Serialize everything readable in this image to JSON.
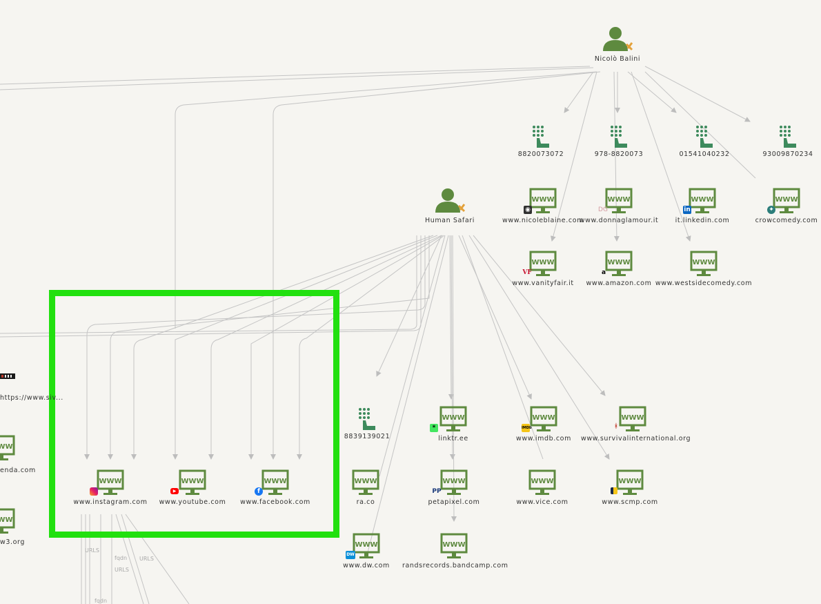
{
  "persons": {
    "nicolo": {
      "label": "Nicolò Balini"
    },
    "human_safari": {
      "label": "Human Safari"
    }
  },
  "phones": {
    "p1": {
      "label": "8820073072"
    },
    "p2": {
      "label": "978-8820073"
    },
    "p3": {
      "label": "01541040232"
    },
    "p4": {
      "label": "93009870234"
    },
    "p5": {
      "label": "8839139021"
    }
  },
  "sites": {
    "nicoleblaine": {
      "label": "www.nicoleblaine.com",
      "badge": "portrait-icon"
    },
    "donnaglamour": {
      "label": "www.donnaglamour.it",
      "badge_text": "DG"
    },
    "linkedin": {
      "label": "it.linkedin.com",
      "badge_text": "in"
    },
    "crowcomedy": {
      "label": "crowcomedy.com",
      "badge": "crow-icon"
    },
    "vanityfair": {
      "label": "www.vanityfair.it",
      "badge_text": "VF"
    },
    "amazon": {
      "label": "www.amazon.com",
      "badge_text": "a"
    },
    "westsidecomedy": {
      "label": "www.westsidecomedy.com"
    },
    "linktree": {
      "label": "linktr.ee",
      "badge_text": "*"
    },
    "imdb": {
      "label": "www.imdb.com",
      "badge_text": "IMDb"
    },
    "survival": {
      "label": "www.survivalinternational.org",
      "badge": "figure-icon"
    },
    "raco": {
      "label": "ra.co"
    },
    "petapixel": {
      "label": "petapixel.com",
      "badge_text": "PP"
    },
    "vice": {
      "label": "www.vice.com"
    },
    "scmp": {
      "label": "www.scmp.com",
      "badge": "scmp-icon"
    },
    "dw": {
      "label": "www.dw.com",
      "badge_text": "DW"
    },
    "bandcamp": {
      "label": "randsrecords.bandcamp.com"
    },
    "instagram": {
      "label": "www.instagram.com",
      "badge": "instagram-icon"
    },
    "youtube": {
      "label": "www.youtube.com",
      "badge": "youtube-icon"
    },
    "facebook": {
      "label": "www.facebook.com",
      "badge_text": "f"
    },
    "left_enda": {
      "label": "enda.com"
    },
    "left_w3": {
      "label": "w3.org"
    }
  },
  "left_url": {
    "label": "https://www.siv..."
  },
  "www_text": "WWW",
  "edge_labels": {
    "urls1": "URLS",
    "fqdn1": "fqdn",
    "urls2": "URLS",
    "urls3": "URLS",
    "fqdn2": "fqdn"
  },
  "colors": {
    "green": "#5e8a3f",
    "teal": "#3d8a5c",
    "highlight": "#22e00f",
    "edge": "#c4c4c4",
    "background": "#f6f5f1"
  }
}
